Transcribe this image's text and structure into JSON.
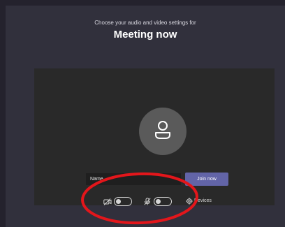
{
  "header": {
    "subtitle": "Choose your audio and video settings for",
    "title": "Meeting now"
  },
  "join_form": {
    "name_placeholder": "Name",
    "join_label": "Join now"
  },
  "controls": {
    "camera": {
      "icon": "camera-off-icon",
      "state": "off"
    },
    "microphone": {
      "icon": "mic-off-icon",
      "state": "off"
    },
    "devices_label": "Devices",
    "devices_icon": "gear-icon"
  },
  "colors": {
    "accent": "#6264a7",
    "annotation": "#e3161b"
  }
}
